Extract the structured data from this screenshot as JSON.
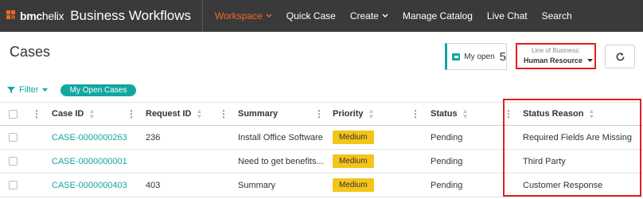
{
  "nav": {
    "logo_bmc": "bmc",
    "logo_helix": "helix",
    "app_title": "Business Workflows",
    "items": [
      {
        "label": "Workspace",
        "active": true,
        "dropdown": true
      },
      {
        "label": "Quick Case",
        "active": false,
        "dropdown": false
      },
      {
        "label": "Create",
        "active": false,
        "dropdown": true
      },
      {
        "label": "Manage Catalog",
        "active": false,
        "dropdown": false
      },
      {
        "label": "Live Chat",
        "active": false,
        "dropdown": false
      },
      {
        "label": "Search",
        "active": false,
        "dropdown": false
      }
    ]
  },
  "page": {
    "title": "Cases"
  },
  "my_open": {
    "label": "My open",
    "count": "5"
  },
  "line_of_business": {
    "label": "Line of Business:",
    "value": "Human Resource"
  },
  "filter": {
    "label": "Filter",
    "chip": "My Open Cases"
  },
  "table": {
    "columns": [
      "Case ID",
      "Request ID",
      "Summary",
      "Priority",
      "Status",
      "Status Reason"
    ],
    "rows": [
      {
        "case_id": "CASE-0000000263",
        "request_id": "236",
        "summary": "Install Office Software",
        "priority": "Medium",
        "status": "Pending",
        "status_reason": "Required Fields Are Missing"
      },
      {
        "case_id": "CASE-0000000001",
        "request_id": "",
        "summary": "Need to get benefits...",
        "priority": "Medium",
        "status": "Pending",
        "status_reason": "Third Party"
      },
      {
        "case_id": "CASE-0000000403",
        "request_id": "403",
        "summary": "Summary",
        "priority": "Medium",
        "status": "Pending",
        "status_reason": "Customer Response"
      }
    ]
  },
  "colors": {
    "accent": "#f26a21",
    "teal": "#12a7a0",
    "nav_bg": "#3a3a3c",
    "priority_medium": "#f4c41a",
    "highlight": "#e02020"
  },
  "icons": {
    "refresh": "refresh-icon",
    "filter": "filter-icon",
    "sort": "sort-icon",
    "column_menu": "column-menu-icon",
    "dropdown": "chevron-down-icon"
  }
}
